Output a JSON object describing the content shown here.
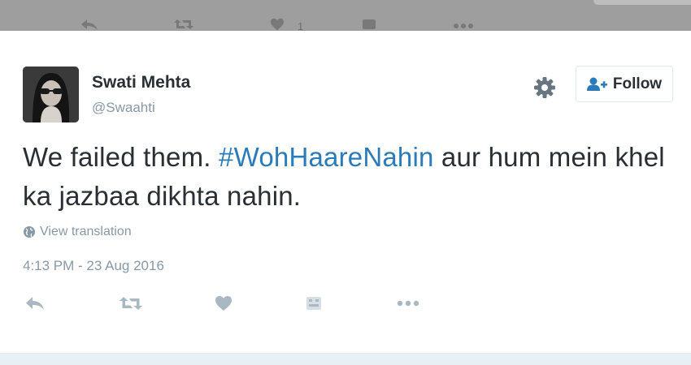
{
  "colors": {
    "text": "#292f33",
    "muted": "#8899a6",
    "link": "#2b7bb9",
    "icon": "#aab8c2",
    "border": "#e1e8ed"
  },
  "background_tweet": {
    "like_count": "1",
    "icons": [
      "reply-icon",
      "retweet-icon",
      "heart-icon",
      "bookmark-icon",
      "more-icon"
    ]
  },
  "tweet": {
    "author": {
      "name": "Swati Mehta",
      "handle": "@Swaahti"
    },
    "follow_label": "Follow",
    "text_parts": {
      "before": "We failed them. ",
      "hashtag": "#WohHaareNahin",
      "after": " aur hum mein khel ka jazbaa dikhta nahin."
    },
    "view_translation": "View translation",
    "timestamp": "4:13 PM - 23 Aug 2016",
    "actions": [
      "reply-icon",
      "retweet-icon",
      "heart-icon",
      "bookmark-icon",
      "more-icon"
    ]
  }
}
